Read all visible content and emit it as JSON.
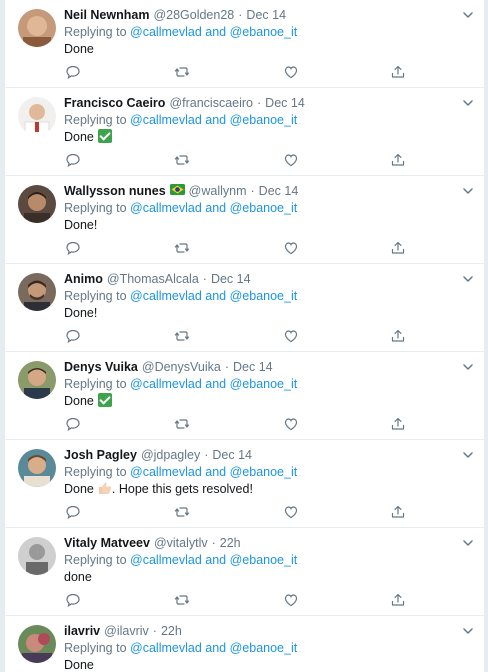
{
  "tweets": [
    {
      "name": "Neil Newnham",
      "handle": "@28Golden28",
      "dot": "·",
      "time": "Dec 14",
      "replying_prefix": "Replying to",
      "mention_1": "@callmevlad",
      "and": "and",
      "mention_2": "@ebanoe_it",
      "text": "Done",
      "text_suffix": "",
      "emoji": "none",
      "flag": false,
      "avatar_color": "#8a5a3a"
    },
    {
      "name": "Francisco Caeiro",
      "handle": "@franciscaeiro",
      "dot": "·",
      "time": "Dec 14",
      "replying_prefix": "Replying to",
      "mention_1": "@callmevlad",
      "and": "and",
      "mention_2": "@ebanoe_it",
      "text": "Done",
      "text_suffix": "",
      "emoji": "check-mark",
      "flag": false,
      "avatar_color": "#e8e4e0"
    },
    {
      "name": "Wallysson nunes",
      "handle": "@wallynm",
      "dot": "·",
      "time": "Dec 14",
      "replying_prefix": "Replying to",
      "mention_1": "@callmevlad",
      "and": "and",
      "mention_2": "@ebanoe_it",
      "text": "Done!",
      "text_suffix": "",
      "emoji": "none",
      "flag": true,
      "avatar_color": "#4a3b32"
    },
    {
      "name": "Animo",
      "handle": "@ThomasAlcala",
      "dot": "·",
      "time": "Dec 14",
      "replying_prefix": "Replying to",
      "mention_1": "@callmevlad",
      "and": "and",
      "mention_2": "@ebanoe_it",
      "text": "Done!",
      "text_suffix": "",
      "emoji": "none",
      "flag": false,
      "avatar_color": "#6b5548"
    },
    {
      "name": "Denys Vuika",
      "handle": "@DenysVuika",
      "dot": "·",
      "time": "Dec 14",
      "replying_prefix": "Replying to",
      "mention_1": "@callmevlad",
      "and": "and",
      "mention_2": "@ebanoe_it",
      "text": "Done",
      "text_suffix": "",
      "emoji": "check-mark",
      "flag": false,
      "avatar_color": "#7a8a5a"
    },
    {
      "name": "Josh Pagley",
      "handle": "@jdpagley",
      "dot": "·",
      "time": "Dec 14",
      "replying_prefix": "Replying to",
      "mention_1": "@callmevlad",
      "and": "and",
      "mention_2": "@ebanoe_it",
      "text": "Done",
      "text_suffix": ". Hope this gets resolved!",
      "emoji": "thumbs-up",
      "flag": false,
      "avatar_color": "#3d6a7a"
    },
    {
      "name": "Vitaly Matveev",
      "handle": "@vitalytlv",
      "dot": "·",
      "time": "22h",
      "replying_prefix": "Replying to",
      "mention_1": "@callmevlad",
      "and": "and",
      "mention_2": "@ebanoe_it",
      "text": "done",
      "text_suffix": "",
      "emoji": "none",
      "flag": false,
      "avatar_color": "#9a9a9a"
    },
    {
      "name": "ilavriv",
      "handle": "@ilavriv",
      "dot": "·",
      "time": "22h",
      "replying_prefix": "Replying to",
      "mention_1": "@callmevlad",
      "and": "and",
      "mention_2": "@ebanoe_it",
      "text": "Done",
      "text_suffix": "",
      "emoji": "none",
      "flag": false,
      "avatar_color": "#8a4a5a"
    }
  ],
  "icons": {
    "reply": "reply-icon",
    "retweet": "retweet-icon",
    "like": "like-icon",
    "share": "share-icon",
    "caret": "chevron-down-icon"
  },
  "colors": {
    "link": "#1b95e0",
    "secondary_text": "#657786",
    "icon": "#657786",
    "divider": "#e6ecf0"
  }
}
